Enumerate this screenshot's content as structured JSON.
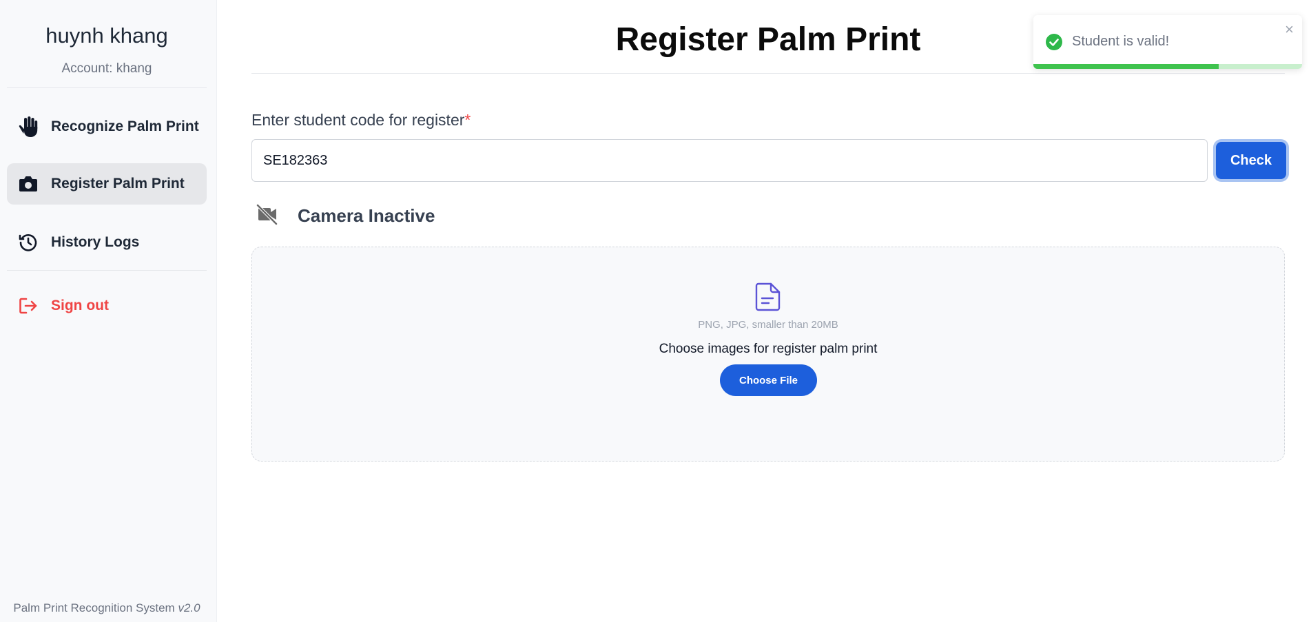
{
  "sidebar": {
    "user_name": "huynh khang",
    "account": "Account: khang",
    "items": [
      {
        "label": "Recognize Palm Print",
        "icon": "hand-icon",
        "active": false
      },
      {
        "label": "Register Palm Print",
        "icon": "camera-icon",
        "active": true
      },
      {
        "label": "History Logs",
        "icon": "history-icon",
        "active": false
      }
    ],
    "signout_label": "Sign out",
    "footer_text": "Palm Print Recognition System",
    "footer_version": "v2.0"
  },
  "main": {
    "title": "Register Palm Print",
    "field_label": "Enter student code for register",
    "required_mark": "*",
    "student_code": "SE182363",
    "check_label": "Check",
    "camera_status": "Camera Inactive",
    "upload_hint": "PNG, JPG, smaller than 20MB",
    "upload_text": "Choose images for register palm print",
    "choose_file_label": "Choose File"
  },
  "toast": {
    "message": "Student is valid!",
    "close_glyph": "×",
    "progress": 0.69
  },
  "colors": {
    "primary": "#1d5fdc",
    "danger": "#ef4444",
    "success": "#3fc34e",
    "file_icon": "#5b53d6"
  }
}
